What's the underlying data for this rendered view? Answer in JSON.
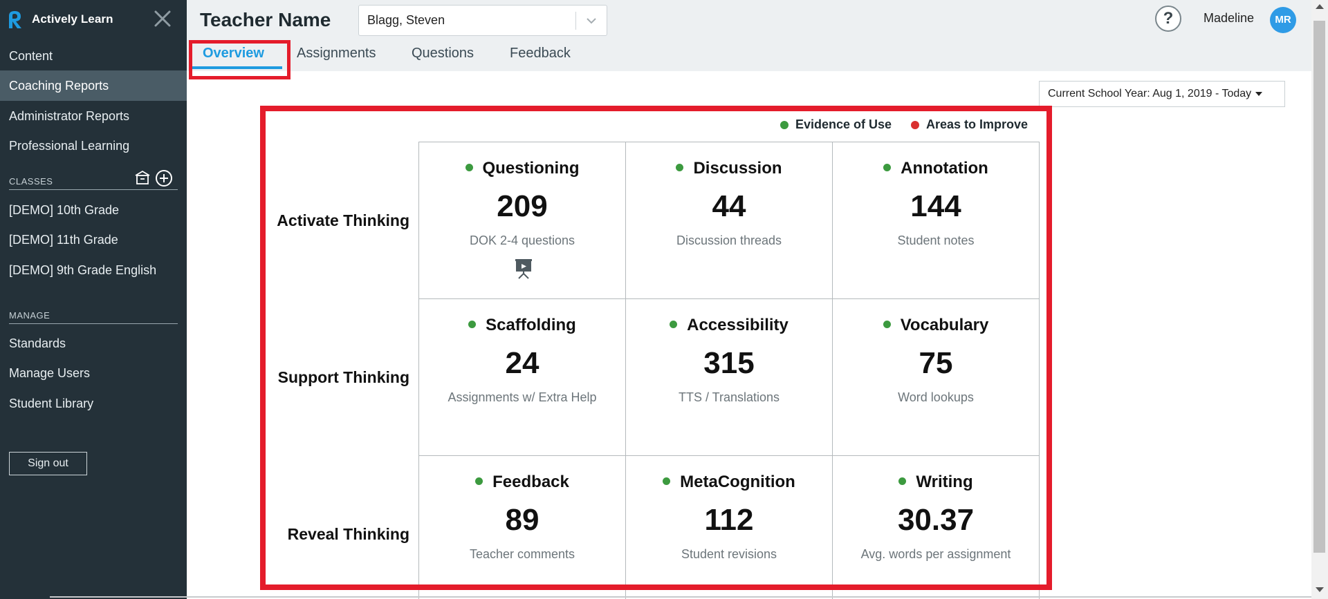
{
  "app": {
    "brand_name": "Actively Learn",
    "brand_color": "#1e9be0"
  },
  "sidebar": {
    "nav_items": [
      {
        "label": "Content",
        "active": false
      },
      {
        "label": "Coaching Reports",
        "active": true
      },
      {
        "label": "Administrator Reports",
        "active": false
      },
      {
        "label": "Professional Learning",
        "active": false
      }
    ],
    "classes_label": "CLASSES",
    "class_action_icons": [
      "archive-icon",
      "add-circle-icon"
    ],
    "classes": [
      {
        "label": "[DEMO] 10th Grade"
      },
      {
        "label": "[DEMO] 11th Grade"
      },
      {
        "label": "[DEMO] 9th Grade English"
      }
    ],
    "manage_label": "MANAGE",
    "manage_items": [
      {
        "label": "Standards"
      },
      {
        "label": "Manage Users"
      },
      {
        "label": "Student Library"
      }
    ],
    "signout_label": "Sign out"
  },
  "header": {
    "title": "Teacher Name",
    "teacher_select_value": "Blagg, Steven",
    "help_label": "?",
    "user_name": "Madeline",
    "user_initials": "MR",
    "tabs": [
      {
        "label": "Overview",
        "active": true
      },
      {
        "label": "Assignments",
        "active": false
      },
      {
        "label": "Questions",
        "active": false
      },
      {
        "label": "Feedback",
        "active": false
      }
    ]
  },
  "main": {
    "date_filter": "Current School Year: Aug 1, 2019 - Today",
    "legend": [
      {
        "label": "Evidence of Use",
        "color": "#3c9a3f"
      },
      {
        "label": "Areas to Improve",
        "color": "#d9302f"
      }
    ],
    "rows": [
      {
        "label": "Activate Thinking",
        "cells": [
          {
            "title": "Questioning",
            "value": "209",
            "desc": "DOK 2-4 questions",
            "icon": "presentation-video-icon",
            "status": "evidence"
          },
          {
            "title": "Discussion",
            "value": "44",
            "desc": "Discussion threads",
            "status": "evidence"
          },
          {
            "title": "Annotation",
            "value": "144",
            "desc": "Student notes",
            "status": "evidence"
          }
        ]
      },
      {
        "label": "Support Thinking",
        "cells": [
          {
            "title": "Scaffolding",
            "value": "24",
            "desc": "Assignments w/ Extra Help",
            "status": "evidence"
          },
          {
            "title": "Accessibility",
            "value": "315",
            "desc": "TTS / Translations",
            "status": "evidence"
          },
          {
            "title": "Vocabulary",
            "value": "75",
            "desc": "Word lookups",
            "status": "evidence"
          }
        ]
      },
      {
        "label": "Reveal Thinking",
        "cells": [
          {
            "title": "Feedback",
            "value": "89",
            "desc": "Teacher comments",
            "status": "evidence"
          },
          {
            "title": "MetaCognition",
            "value": "112",
            "desc": "Student revisions",
            "status": "evidence"
          },
          {
            "title": "Writing",
            "value": "30.37",
            "desc": "Avg. words per assignment",
            "status": "evidence"
          }
        ]
      }
    ]
  }
}
